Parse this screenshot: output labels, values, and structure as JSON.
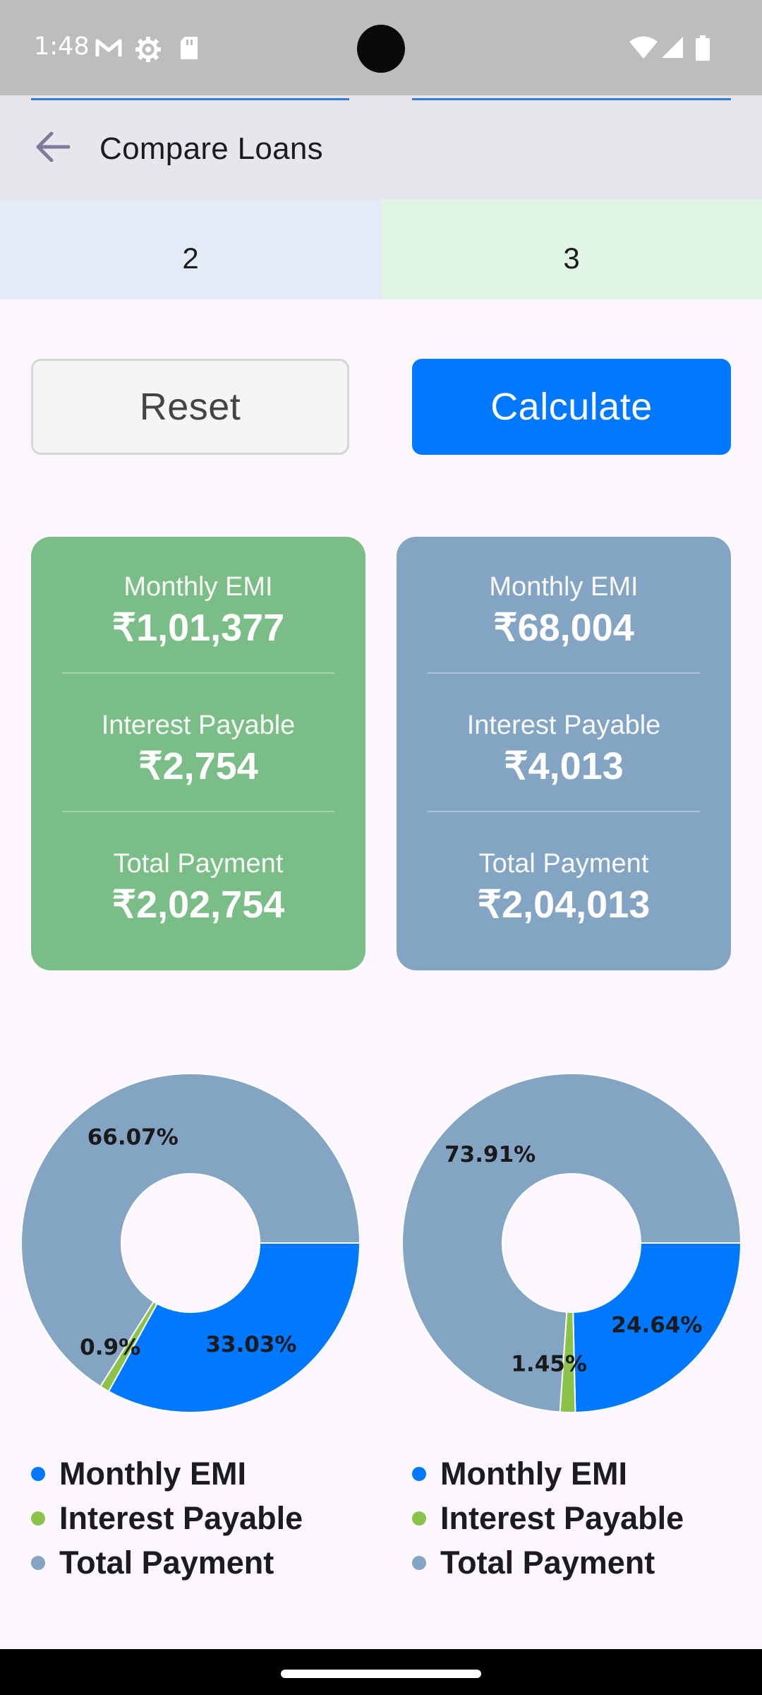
{
  "status_bar": {
    "time": "1:48",
    "left_icons": [
      "gmail-icon",
      "settings-icon",
      "sd-card-icon"
    ],
    "right_icons": [
      "wifi-icon",
      "signal-icon",
      "battery-icon"
    ]
  },
  "app_bar": {
    "back_icon": "arrow-back-icon",
    "title": "Compare Loans"
  },
  "inputs": {
    "loan1_value": "2",
    "loan2_value": "3"
  },
  "buttons": {
    "reset": "Reset",
    "calculate": "Calculate"
  },
  "colors": {
    "accent": "#0078ff",
    "card1": "#7bbd86",
    "card2": "#84a4c4",
    "monthly_emi": "#0078ff",
    "interest_payable": "#8bc34a",
    "total_payment": "#84a4c4"
  },
  "results": [
    {
      "emi_label": "Monthly EMI",
      "emi_value": "₹1,01,377",
      "interest_label": "Interest Payable",
      "interest_value": "₹2,754",
      "total_label": "Total Payment",
      "total_value": "₹2,02,754"
    },
    {
      "emi_label": "Monthly EMI",
      "emi_value": "₹68,004",
      "interest_label": "Interest Payable",
      "interest_value": "₹4,013",
      "total_label": "Total Payment",
      "total_value": "₹2,04,013"
    }
  ],
  "chart_data": [
    {
      "type": "pie",
      "categories": [
        "Monthly EMI",
        "Interest Payable",
        "Total Payment"
      ],
      "values": [
        33.03,
        0.9,
        66.07
      ],
      "labels": [
        "33.03%",
        "0.9%",
        "66.07%"
      ],
      "colors": [
        "#0078ff",
        "#8bc34a",
        "#84a4c4"
      ],
      "legend": "bottom"
    },
    {
      "type": "pie",
      "categories": [
        "Monthly EMI",
        "Interest Payable",
        "Total Payment"
      ],
      "values": [
        24.64,
        1.45,
        73.91
      ],
      "labels": [
        "24.64%",
        "1.45%",
        "73.91%"
      ],
      "colors": [
        "#0078ff",
        "#8bc34a",
        "#84a4c4"
      ],
      "legend": "bottom"
    }
  ],
  "legends": [
    {
      "items": [
        "Monthly EMI",
        "Interest Payable",
        "Total Payment"
      ]
    },
    {
      "items": [
        "Monthly EMI",
        "Interest Payable",
        "Total Payment"
      ]
    }
  ]
}
